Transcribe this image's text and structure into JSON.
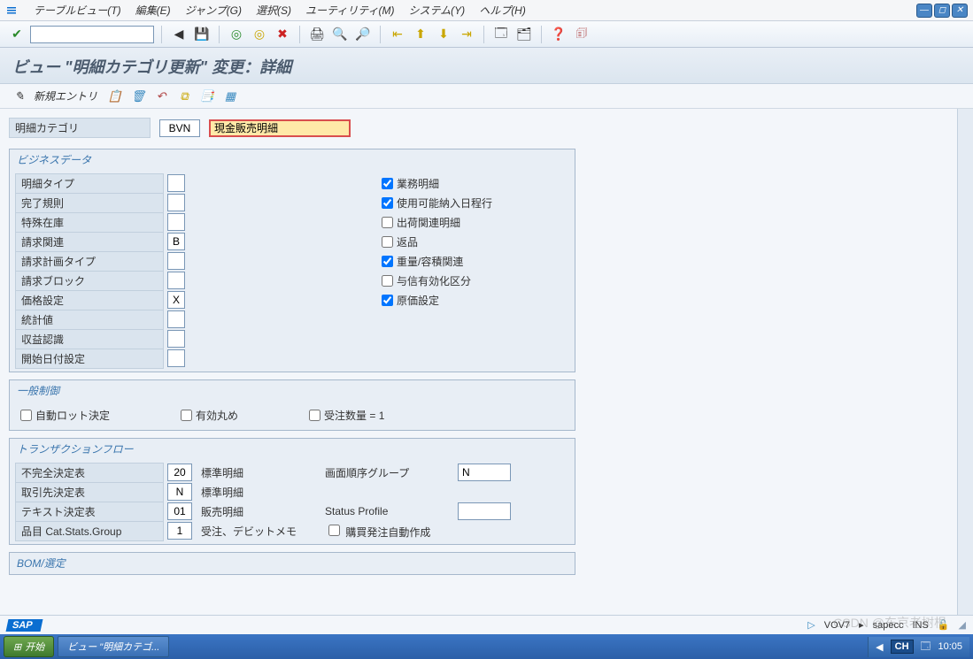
{
  "menu": {
    "items": [
      "テーブルビュー(T)",
      "編集(E)",
      "ジャンプ(G)",
      "選択(S)",
      "ユーティリティ(M)",
      "システム(Y)",
      "ヘルプ(H)"
    ]
  },
  "title": "ビュー  \"明細カテゴリ更新\"  変更：詳細",
  "app_toolbar": {
    "new_entry": "新規エントリ"
  },
  "header": {
    "label": "明細カテゴリ",
    "code": "BVN",
    "desc": "現金販売明細"
  },
  "groups": {
    "business": {
      "title": "ビジネスデータ",
      "left": [
        {
          "label": "明細タイプ",
          "value": ""
        },
        {
          "label": "完了規則",
          "value": ""
        },
        {
          "label": "特殊在庫",
          "value": ""
        },
        {
          "label": "請求関連",
          "value": "B"
        },
        {
          "label": "請求計画タイプ",
          "value": ""
        },
        {
          "label": "請求ブロック",
          "value": ""
        },
        {
          "label": "価格設定",
          "value": "X"
        },
        {
          "label": "統計値",
          "value": ""
        },
        {
          "label": "収益認識",
          "value": ""
        },
        {
          "label": "開始日付設定",
          "value": ""
        }
      ],
      "right": [
        {
          "label": "業務明細",
          "checked": true
        },
        {
          "label": "使用可能納入日程行",
          "checked": true
        },
        {
          "label": "出荷関連明細",
          "checked": false
        },
        {
          "label": "返品",
          "checked": false
        },
        {
          "label": "重量/容積関連",
          "checked": true
        },
        {
          "label": "与信有効化区分",
          "checked": false
        },
        {
          "label": "原価設定",
          "checked": true
        }
      ]
    },
    "general": {
      "title": "一般制御",
      "items": [
        {
          "label": "自動ロット決定",
          "checked": false
        },
        {
          "label": "有効丸め",
          "checked": false
        },
        {
          "label": "受注数量 = 1",
          "checked": false
        }
      ]
    },
    "transaction": {
      "title": "トランザクションフロー",
      "rows": [
        {
          "label": "不完全決定表",
          "value": "20",
          "mid": "標準明細",
          "rlabel": "画面順序グループ",
          "rvalue": "N"
        },
        {
          "label": "取引先決定表",
          "value": "N",
          "mid": "標準明細",
          "rlabel": "",
          "rvalue": ""
        },
        {
          "label": "テキスト決定表",
          "value": "01",
          "mid": "販売明細",
          "rlabel": "Status Profile",
          "rvalue": ""
        },
        {
          "label": "品目 Cat.Stats.Group",
          "value": "1",
          "mid": "受注、デビットメモ",
          "rlabel_cbx": "購買発注自動作成",
          "rchecked": false
        }
      ]
    },
    "bom": {
      "title": "BOM/選定"
    }
  },
  "status": {
    "tcode": "VOV7",
    "system": "sapecc",
    "mode": "INS"
  },
  "taskbar": {
    "start": "开始",
    "task1": "ビュー \"明細カテゴ...",
    "ime": "CH",
    "time": "10:05"
  },
  "watermark": "CSDN @东京老树根"
}
